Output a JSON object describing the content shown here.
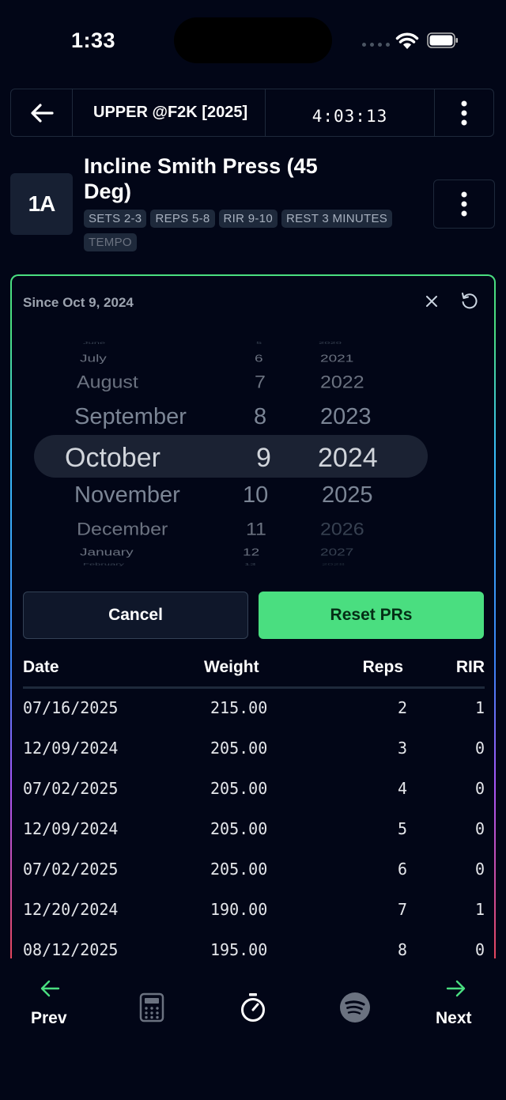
{
  "status": {
    "time": "1:33"
  },
  "header": {
    "title": "UPPER @F2K [2025]",
    "timer": "4:03:13"
  },
  "exercise": {
    "badge": "1A",
    "name": "Incline Smith Press (45 Deg)",
    "chips": [
      "SETS 2-3",
      "REPS 5-8",
      "RIR 9-10",
      "REST 3 MINUTES",
      "TEMPO"
    ]
  },
  "card": {
    "since": "Since Oct 9, 2024",
    "picker": {
      "months": [
        "June",
        "July",
        "August",
        "September",
        "October",
        "November",
        "December",
        "January",
        "February"
      ],
      "days": [
        "5",
        "6",
        "7",
        "8",
        "9",
        "10",
        "11",
        "12",
        "13"
      ],
      "years": [
        "2020",
        "2021",
        "2022",
        "2023",
        "2024",
        "2025",
        "2026",
        "2027",
        "2028"
      ]
    },
    "cancel_label": "Cancel",
    "reset_label": "Reset PRs",
    "table": {
      "headers": {
        "date": "Date",
        "weight": "Weight",
        "reps": "Reps",
        "rir": "RIR"
      },
      "rows": [
        {
          "date": "07/16/2025",
          "weight": "215.00",
          "reps": "2",
          "rir": "1"
        },
        {
          "date": "12/09/2024",
          "weight": "205.00",
          "reps": "3",
          "rir": "0"
        },
        {
          "date": "07/02/2025",
          "weight": "205.00",
          "reps": "4",
          "rir": "0"
        },
        {
          "date": "12/09/2024",
          "weight": "205.00",
          "reps": "5",
          "rir": "0"
        },
        {
          "date": "07/02/2025",
          "weight": "205.00",
          "reps": "6",
          "rir": "0"
        },
        {
          "date": "12/20/2024",
          "weight": "190.00",
          "reps": "7",
          "rir": "1"
        },
        {
          "date": "08/12/2025",
          "weight": "195.00",
          "reps": "8",
          "rir": "0"
        }
      ]
    }
  },
  "nav": {
    "prev": "Prev",
    "next": "Next"
  },
  "colors": {
    "accent": "#4ade80",
    "bg": "#020617"
  },
  "icons": [
    "back-arrow-icon",
    "more-vertical-icon",
    "close-icon",
    "reset-icon",
    "calculator-icon",
    "stopwatch-icon",
    "spotify-icon"
  ]
}
